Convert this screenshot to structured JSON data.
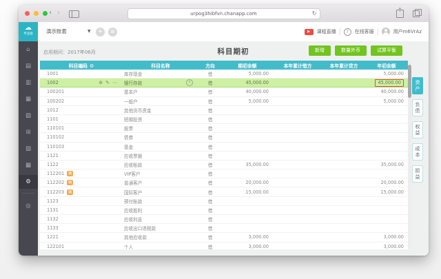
{
  "browser": {
    "url": "urpog3hibfvn.chanapp.com",
    "reload_icon": "↻"
  },
  "app": {
    "edition": "专业版",
    "logo_icon": "☁",
    "account_set": "演示账套",
    "live_badge": "▶",
    "live_label": "课程直播",
    "support_icon": "?",
    "support_label": "在线客服",
    "user_label": "用户m6VrAz"
  },
  "sidebar": {
    "icons": [
      {
        "name": "home",
        "glyph": "⌂"
      },
      {
        "name": "voucher",
        "glyph": "▤"
      },
      {
        "name": "ledger",
        "glyph": "▥"
      },
      {
        "name": "report",
        "glyph": "▦"
      },
      {
        "name": "funds",
        "glyph": "▧"
      },
      {
        "name": "invoice",
        "glyph": "⊞"
      },
      {
        "name": "salary",
        "glyph": "▨"
      },
      {
        "name": "fixed-assets",
        "glyph": "▩"
      },
      {
        "name": "settings",
        "glyph": "⚙",
        "active": true
      }
    ],
    "bottom_icon": {
      "name": "promo",
      "glyph": "◎"
    }
  },
  "page": {
    "period_label": "启用期间：",
    "period_value": "2017年06月",
    "title": "科目期初",
    "buttons": [
      "新增",
      "数量外币",
      "试算平衡"
    ]
  },
  "table": {
    "columns": [
      "科目编码",
      "科目名称",
      "方向",
      "期初余额",
      "本年累计借方",
      "本年累计贷方",
      "年初余额"
    ],
    "column_settings_icon": "⚙",
    "row_action_icons": [
      "⊕",
      "✎",
      "⋯"
    ],
    "row_help_icon": "?",
    "rows": [
      {
        "code": "1001",
        "badge": "",
        "name": "库存现金",
        "dir": "借",
        "opening": "5,000.00",
        "ytd_debit": "",
        "ytd_credit": "",
        "year_begin": "5,000.00"
      },
      {
        "code": "1002",
        "badge": "",
        "name": "银行存款",
        "dir": "借",
        "opening": "45,000.00",
        "ytd_debit": "",
        "ytd_credit": "",
        "year_begin": "45,000.00",
        "highlighted": true,
        "has_actions": true,
        "boxed_year": true
      },
      {
        "code": "100201",
        "badge": "",
        "name": "基本户",
        "dir": "借",
        "opening": "40,000.00",
        "ytd_debit": "",
        "ytd_credit": "",
        "year_begin": "40,000.00"
      },
      {
        "code": "100202",
        "badge": "",
        "name": "一般户",
        "dir": "借",
        "opening": "5,000.00",
        "ytd_debit": "",
        "ytd_credit": "",
        "year_begin": "5,000.00"
      },
      {
        "code": "1012",
        "badge": "",
        "name": "其他货币资金",
        "dir": "借",
        "opening": "",
        "ytd_debit": "",
        "ytd_credit": "",
        "year_begin": ""
      },
      {
        "code": "1101",
        "badge": "",
        "name": "短期投资",
        "dir": "借",
        "opening": "",
        "ytd_debit": "",
        "ytd_credit": "",
        "year_begin": ""
      },
      {
        "code": "110101",
        "badge": "",
        "name": "股票",
        "dir": "借",
        "opening": "",
        "ytd_debit": "",
        "ytd_credit": "",
        "year_begin": ""
      },
      {
        "code": "110102",
        "badge": "",
        "name": "债券",
        "dir": "借",
        "opening": "",
        "ytd_debit": "",
        "ytd_credit": "",
        "year_begin": ""
      },
      {
        "code": "110103",
        "badge": "",
        "name": "基金",
        "dir": "借",
        "opening": "",
        "ytd_debit": "",
        "ytd_credit": "",
        "year_begin": ""
      },
      {
        "code": "1121",
        "badge": "",
        "name": "应收票据",
        "dir": "借",
        "opening": "",
        "ytd_debit": "",
        "ytd_credit": "",
        "year_begin": ""
      },
      {
        "code": "1122",
        "badge": "",
        "name": "应收账款",
        "dir": "借",
        "opening": "35,000.00",
        "ytd_debit": "",
        "ytd_credit": "",
        "year_begin": "35,000.00"
      },
      {
        "code": "112201",
        "badge": "辅",
        "name": "VIP客户",
        "dir": "借",
        "opening": "",
        "ytd_debit": "",
        "ytd_credit": "",
        "year_begin": ""
      },
      {
        "code": "112202",
        "badge": "辅",
        "name": "普通客户",
        "dir": "借",
        "opening": "20,000.00",
        "ytd_debit": "",
        "ytd_credit": "",
        "year_begin": "20,000.00"
      },
      {
        "code": "112203",
        "badge": "辅",
        "name": "国际客户",
        "dir": "借",
        "opening": "15,000.00",
        "ytd_debit": "",
        "ytd_credit": "",
        "year_begin": "15,000.00"
      },
      {
        "code": "1123",
        "badge": "",
        "name": "预付账款",
        "dir": "借",
        "opening": "",
        "ytd_debit": "",
        "ytd_credit": "",
        "year_begin": ""
      },
      {
        "code": "1131",
        "badge": "",
        "name": "应收股利",
        "dir": "借",
        "opening": "",
        "ytd_debit": "",
        "ytd_credit": "",
        "year_begin": ""
      },
      {
        "code": "1132",
        "badge": "",
        "name": "应收利息",
        "dir": "借",
        "opening": "",
        "ytd_debit": "",
        "ytd_credit": "",
        "year_begin": ""
      },
      {
        "code": "1133",
        "badge": "",
        "name": "应收出口退税款",
        "dir": "借",
        "opening": "",
        "ytd_debit": "",
        "ytd_credit": "",
        "year_begin": ""
      },
      {
        "code": "1221",
        "badge": "",
        "name": "其他应收款",
        "dir": "借",
        "opening": "3,000.00",
        "ytd_debit": "",
        "ytd_credit": "",
        "year_begin": "3,000.00"
      },
      {
        "code": "122101",
        "badge": "",
        "name": "个人",
        "dir": "借",
        "opening": "3,000.00",
        "ytd_debit": "",
        "ytd_credit": "",
        "year_begin": "3,000.00",
        "clipped": true
      }
    ]
  },
  "side_tabs": [
    {
      "label": "资产",
      "active": true
    },
    {
      "label": "负债",
      "active": false
    },
    {
      "label": "权益",
      "active": false
    },
    {
      "label": "成本",
      "active": false
    },
    {
      "label": "损益",
      "active": false
    }
  ],
  "colors": {
    "accent_green": "#72c41f",
    "table_header_cyan": "#43bcca",
    "row_highlight_green": "#cdf0a2",
    "badge_orange": "#f5a84e",
    "alert_box_red": "#e5493d",
    "sidebar_bg": "#47474f",
    "logo_teal": "#2bb5c4"
  }
}
